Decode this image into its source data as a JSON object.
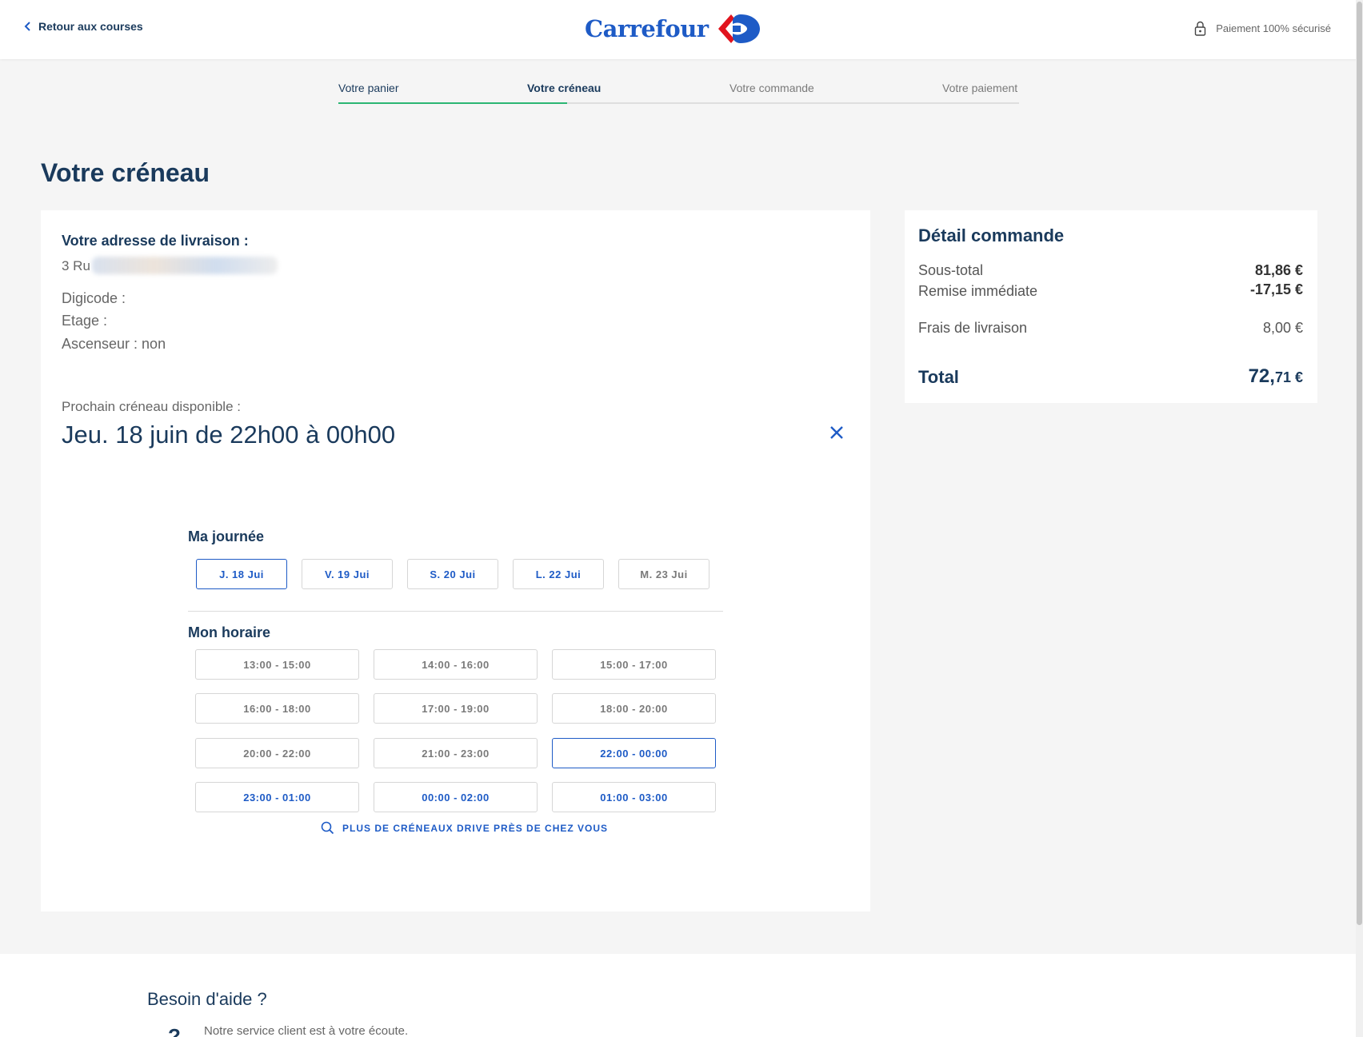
{
  "header": {
    "back_label": "Retour aux courses",
    "brand_name": "Carrefour",
    "brand_colors": {
      "blue": "#1e5bc6",
      "red": "#e1141e"
    },
    "secure_label": "Paiement 100% sécurisé",
    "back_icon": "chevron-left-icon",
    "secure_icon": "lock-icon"
  },
  "steps": {
    "items": [
      {
        "label": "Votre panier",
        "state": "done"
      },
      {
        "label": "Votre créneau",
        "state": "active"
      },
      {
        "label": "Votre commande",
        "state": "todo"
      },
      {
        "label": "Votre paiement",
        "state": "todo"
      }
    ],
    "progress_color": "#2bb673"
  },
  "page_title": "Votre créneau",
  "delivery": {
    "address_title": "Votre adresse de livraison :",
    "address_line": "3 Ru",
    "digicode": "Digicode :",
    "etage": "Etage :",
    "ascenseur": "Ascenseur : non",
    "next_slot_label": "Prochain créneau disponible :",
    "next_slot_value": "Jeu. 18 juin de 22h00 à 00h00",
    "close_icon": "close-icon"
  },
  "day_picker": {
    "title": "Ma journée",
    "days": [
      {
        "label": "J. 18 Jui",
        "state": "selected"
      },
      {
        "label": "V. 19 Jui",
        "state": "available"
      },
      {
        "label": "S. 20 Jui",
        "state": "available"
      },
      {
        "label": "L. 22 Jui",
        "state": "available"
      },
      {
        "label": "M. 23 Jui",
        "state": "muted"
      }
    ]
  },
  "time_picker": {
    "title": "Mon horaire",
    "slots": [
      {
        "label": "13:00 - 15:00",
        "state": "disabled"
      },
      {
        "label": "14:00 - 16:00",
        "state": "disabled"
      },
      {
        "label": "15:00 - 17:00",
        "state": "disabled"
      },
      {
        "label": "16:00 - 18:00",
        "state": "disabled"
      },
      {
        "label": "17:00 - 19:00",
        "state": "disabled"
      },
      {
        "label": "18:00 - 20:00",
        "state": "disabled"
      },
      {
        "label": "20:00 - 22:00",
        "state": "disabled"
      },
      {
        "label": "21:00 - 23:00",
        "state": "disabled"
      },
      {
        "label": "22:00 - 00:00",
        "state": "selected"
      },
      {
        "label": "23:00 - 01:00",
        "state": "available"
      },
      {
        "label": "00:00 - 02:00",
        "state": "available"
      },
      {
        "label": "01:00 - 03:00",
        "state": "available"
      }
    ],
    "more_label": "PLUS DE CRÉNEAUX DRIVE PRÈS DE CHEZ VOUS",
    "more_icon": "search-icon"
  },
  "summary": {
    "title": "Détail commande",
    "subtotal_label": "Sous-total",
    "subtotal_value": "81,86 €",
    "discount_label": "Remise immédiate",
    "discount_value": "-17,15 €",
    "delivery_label": "Frais de livraison",
    "delivery_value": "8,00 €",
    "total_label": "Total",
    "total_int": "72,",
    "total_dec": "71 €"
  },
  "footer": {
    "help_title": "Besoin d'aide ?",
    "help_text": "Notre service client est à votre écoute.",
    "help_icon_glyph": "?"
  },
  "colors": {
    "navy": "#1a3a5c",
    "accent_blue": "#1e5bc6",
    "background": "#f5f5f5"
  }
}
